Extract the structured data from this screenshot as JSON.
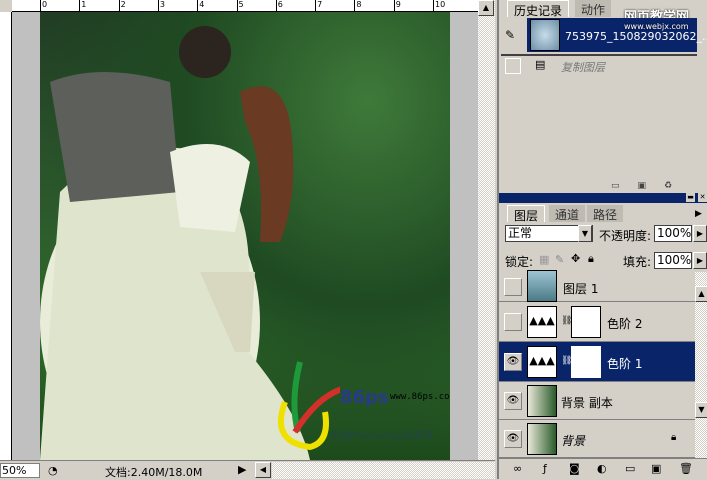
{
  "document": {
    "zoom": "50%",
    "doc_info": "文档:2.40M/18.0M",
    "ruler_ticks": [
      "0",
      "1",
      "2",
      "3",
      "4",
      "5",
      "6",
      "7",
      "8",
      "9",
      "10"
    ]
  },
  "watermark": {
    "logo_text": "86ps",
    "url": "www.86ps.com",
    "tagline": "中国Photoshop资源网"
  },
  "site_watermark": {
    "title": "网页教学网",
    "url": "www.webjx.com"
  },
  "history_panel": {
    "tabs": [
      {
        "label": "历史记录",
        "active": true
      },
      {
        "label": "动作",
        "active": false
      }
    ],
    "snapshot": "753975_150829032062_...",
    "items": [
      {
        "label": "复制图层",
        "state": "greyed"
      }
    ]
  },
  "layers_panel": {
    "tabs": [
      {
        "label": "图层",
        "active": true
      },
      {
        "label": "通道",
        "active": false
      },
      {
        "label": "路径",
        "active": false
      }
    ],
    "blend_mode": "正常",
    "opacity_label": "不透明度:",
    "opacity": "100%",
    "lock_label": "锁定:",
    "fill_label": "填充:",
    "fill": "100%",
    "layers": [
      {
        "name": "图层 1",
        "visible": false,
        "type": "pixel",
        "selected": false
      },
      {
        "name": "色阶 2",
        "visible": false,
        "type": "levels",
        "selected": false
      },
      {
        "name": "色阶 1",
        "visible": true,
        "type": "levels",
        "selected": true
      },
      {
        "name": "背景 副本",
        "visible": true,
        "type": "pixel",
        "selected": false
      },
      {
        "name": "背景",
        "visible": true,
        "type": "background",
        "selected": false,
        "locked": true
      }
    ]
  },
  "colors": {
    "selection": "#0a246a",
    "panel": "#d4d0c8"
  }
}
